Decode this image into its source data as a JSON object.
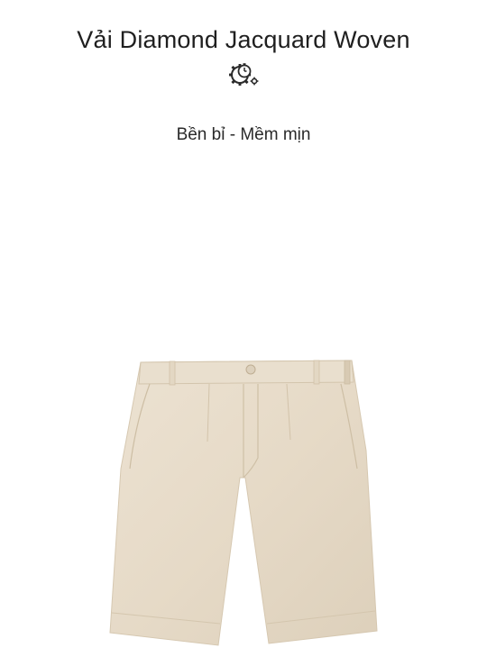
{
  "feature": {
    "title": "Vải Diamond Jacquard Woven",
    "icon": "gear-stopwatch-icon",
    "subtitle": "Bền bỉ - Mềm mịn"
  },
  "product": {
    "image": "beige-chino-shorts",
    "color": "#e7dccb"
  }
}
